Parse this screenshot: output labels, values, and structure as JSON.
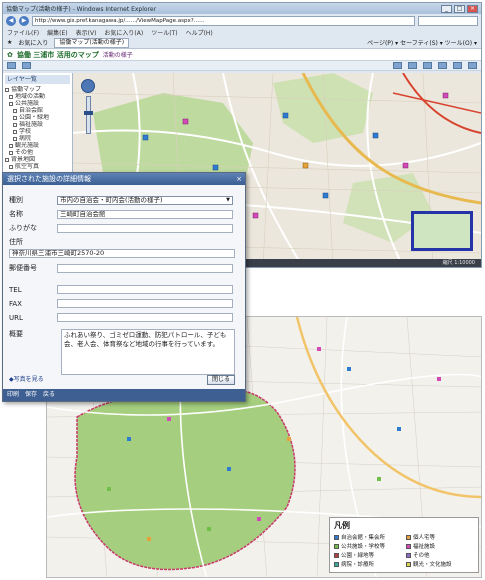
{
  "browser": {
    "title": "協働マップ(活動の様子) - Windows Internet Explorer",
    "address": "http://www.gis.pref.kanagawa.jp/……/ViewMapPage.aspx?……",
    "menu": [
      "ファイル(F)",
      "編集(E)",
      "表示(V)",
      "お気に入り(A)",
      "ツール(T)",
      "ヘルプ(H)"
    ],
    "favorites_label": "お気に入り",
    "tab_label": "協働マップ(活動の様子)",
    "tools_right": "ページ(P) ▾  セーフティ(S) ▾  ツール(O) ▾"
  },
  "app": {
    "title": "協働 三浦市 活用のマップ",
    "subtitle": "活動の様子"
  },
  "sidebar": {
    "header": "レイヤ一覧",
    "items": [
      {
        "label": "協働マップ",
        "indent": 0
      },
      {
        "label": "地域の活動",
        "indent": 1
      },
      {
        "label": "公共施設",
        "indent": 1
      },
      {
        "label": "自治会館",
        "indent": 2
      },
      {
        "label": "公園・緑地",
        "indent": 2
      },
      {
        "label": "福祉施設",
        "indent": 2
      },
      {
        "label": "学校",
        "indent": 2
      },
      {
        "label": "病院",
        "indent": 2
      },
      {
        "label": "観光施設",
        "indent": 1
      },
      {
        "label": "その他",
        "indent": 1
      },
      {
        "label": "背景地図",
        "indent": 0
      },
      {
        "label": "航空写真",
        "indent": 1
      }
    ]
  },
  "map": {
    "status": "縮尺 1:10000"
  },
  "dialog": {
    "title": "選択された施設の詳細情報",
    "close_x": "×",
    "category_label": "種別",
    "category_value": "市内の自治会・町内会(活動の様子)",
    "name_label": "名称",
    "name_value": "三崎町自治会館",
    "reading_label": "ふりがな",
    "reading_value": "",
    "address_label": "住所",
    "address_value": "神奈川県三浦市三崎町2570-20",
    "zip_label": "郵便番号",
    "zip_value": "",
    "tel_label": "TEL",
    "tel_value": "",
    "fax_label": "FAX",
    "fax_value": "",
    "url_label": "URL",
    "url_value": "",
    "note_label": "概要",
    "note_value": "ふれあい祭り、ゴミゼロ運動、防犯パトロール、子ども会、老人会、体育祭など地域の行事を行っています。",
    "link_label": "◆写真を見る",
    "close_button": "閉じる",
    "footer": [
      "印刷",
      "保存",
      "戻る"
    ]
  },
  "legend": {
    "title": "凡例",
    "items": [
      {
        "label": "自治会館・集会所",
        "color": "#2e7bd1"
      },
      {
        "label": "個人宅等",
        "color": "#e6a23c"
      },
      {
        "label": "公共施設・学校等",
        "color": "#6fbf4a"
      },
      {
        "label": "福祉施設",
        "color": "#d14ab8"
      },
      {
        "label": "公園・緑地等",
        "color": "#b34141"
      },
      {
        "label": "その他",
        "color": "#8d6bc7"
      },
      {
        "label": "病院・診療所",
        "color": "#3aa9a0"
      },
      {
        "label": "観光・文化施設",
        "color": "#d9d24c"
      }
    ]
  },
  "colors": {
    "green_area": "#a5cf7e",
    "road": "#ffffff",
    "road_major": "#f2c46a",
    "road_red": "#d8432f",
    "boundary": "#c8386a"
  }
}
